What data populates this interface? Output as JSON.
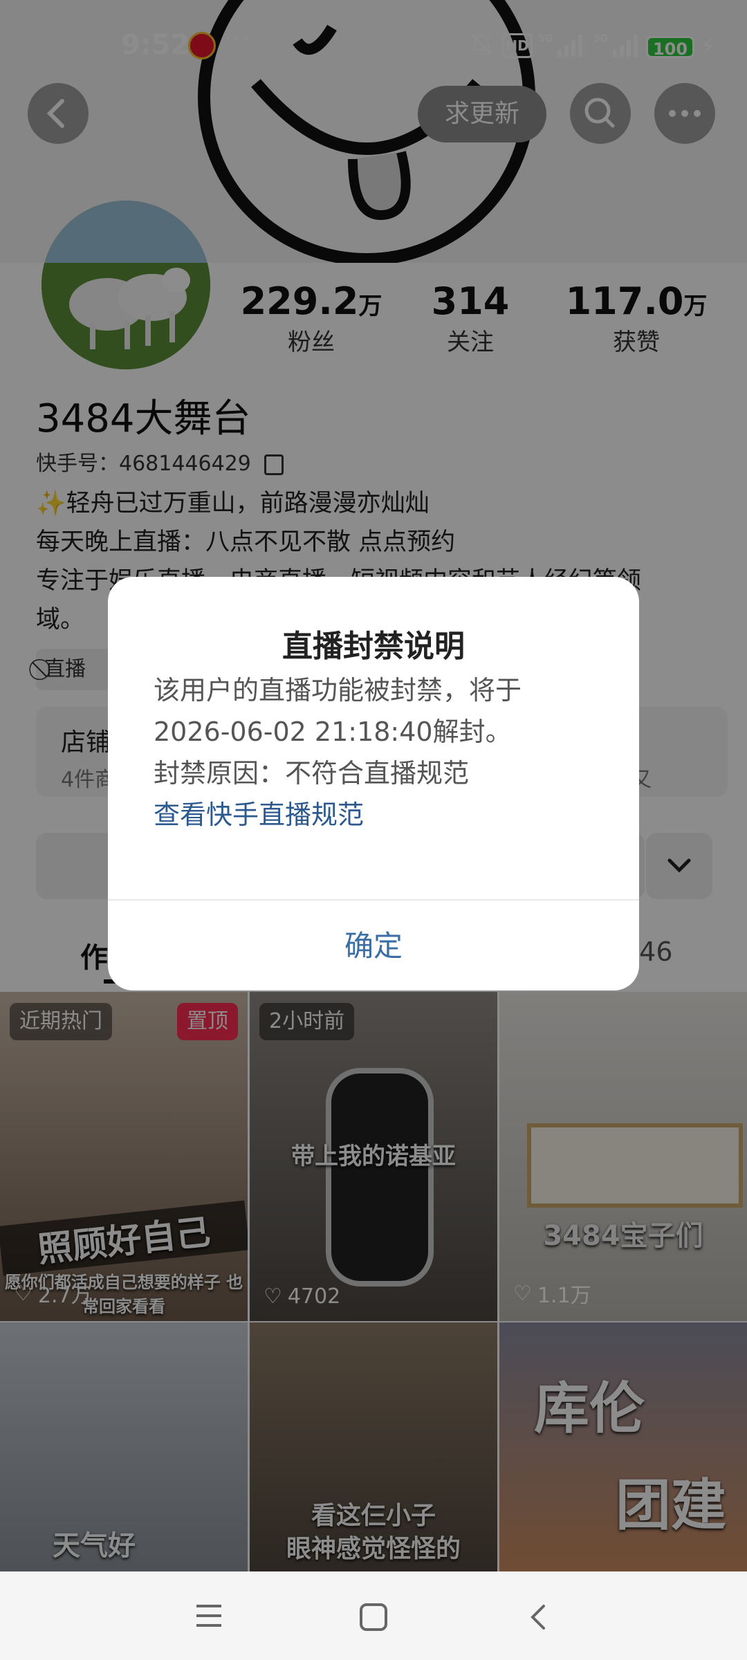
{
  "status_bar": {
    "time": "9:52",
    "more_dots": "···",
    "hd_label": "HD",
    "network_1": "5G",
    "network_2": "5G",
    "battery": "100"
  },
  "header": {
    "request_update_label": "求更新",
    "icons": [
      "back-arrow-icon",
      "search-icon",
      "more-icon"
    ]
  },
  "profile": {
    "stats": [
      {
        "value": "229.2",
        "unit": "万",
        "label": "粉丝"
      },
      {
        "value": "314",
        "unit": "",
        "label": "关注"
      },
      {
        "value": "117.0",
        "unit": "万",
        "label": "获赞"
      }
    ],
    "username": "3484大舞台",
    "kuaishou_id": "快手号：4681446429",
    "bio_lines": [
      "✨轻舟已过万重山，前路漫漫亦灿灿",
      "每天晚上直播：八点不见不散 点点预约",
      "专注于娱乐直播、电商直播、短视频内容和艺人经纪等领",
      "域。"
    ],
    "tag_chip": "直播",
    "shop_title": "店铺",
    "shop_sub": "4件商",
    "shop_right": "又",
    "tab_left": "作",
    "tab_right": "446"
  },
  "grid": [
    {
      "tag": "近期热门",
      "pin": "置顶",
      "likes": "2.7万",
      "caption": "照顾好自己",
      "subcaption": "愿你们都活成自己想要的样子 也常回家看看"
    },
    {
      "tag": "2小时前",
      "likes": "4702",
      "caption": "带上我的诺基亚"
    },
    {
      "likes": "1.1万",
      "caption": "3484宝子们"
    },
    {
      "caption": "天气好"
    },
    {
      "caption": "看这仨小子",
      "caption2": "眼神感觉怪怪的"
    },
    {
      "caption": "库伦",
      "caption2": "团建"
    }
  ],
  "dialog": {
    "title": "直播封禁说明",
    "line1": "该用户的直播功能被封禁，将于",
    "line2": "2026-06-02 21:18:40解封。",
    "line3": "封禁原因：不符合直播规范",
    "link": "查看快手直播规范",
    "confirm": "确定"
  },
  "colors": {
    "overlay": "#000000",
    "link": "#2c5a8f",
    "confirm": "#3a6ea5",
    "pin_tag": "#ff2d55"
  }
}
